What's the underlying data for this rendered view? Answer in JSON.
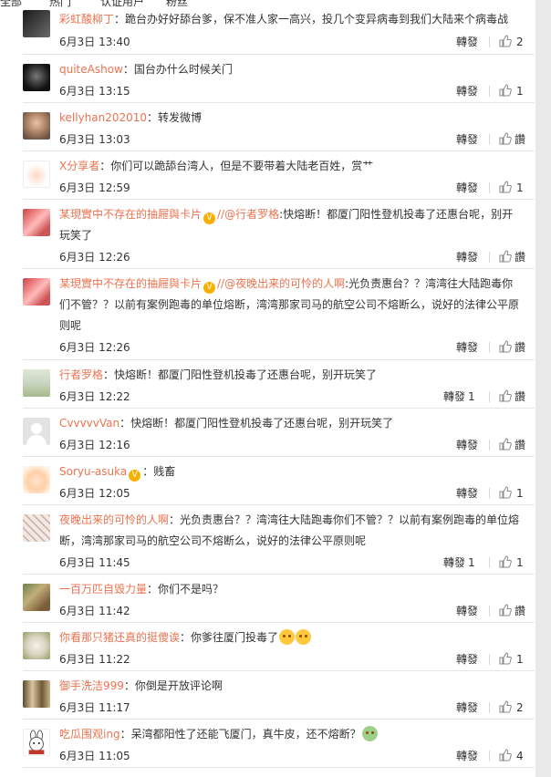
{
  "header_tabs": [
    "全部",
    "热门",
    "认证用户",
    "粉丝"
  ],
  "labels": {
    "repost": "轉發",
    "praise": "讚"
  },
  "colors": {
    "username": "#eb7350",
    "text": "#333333",
    "separator": "#e6e6e6"
  },
  "comments": [
    {
      "user": "彩虹酸柳丁",
      "text": "：跪台办好好舔台爹，保不准人家一高兴，投几个变异病毒到我们大陆来个病毒战",
      "time": "6月3日 13:40",
      "likes": "2",
      "avatar": "anime-girl-avatar"
    },
    {
      "user": "quiteAshow",
      "text": "：国台办什么时候关门",
      "time": "6月3日 13:15",
      "likes": "1",
      "avatar": "dark-face-avatar"
    },
    {
      "user": "kellyhan202010",
      "text": "：转发微博",
      "time": "6月3日 13:03",
      "likes": "讚",
      "avatar": "man-photo-avatar"
    },
    {
      "user": "X分享者",
      "text": "：你们可以跪舔台湾人，但是不要带着大陆老百姓，赏艹",
      "time": "6月3日 12:59",
      "likes": "1",
      "avatar": "cartoon-avatar"
    },
    {
      "user": "某現實中不存在的抽屜與卡片",
      "mention": "//@行者罗格",
      "text": ":快熔断！都厦门阳性登机投毒了还惠台呢，别开玩笑了",
      "time": "6月3日 12:26",
      "likes": "讚",
      "avatar": "food-photo-avatar"
    },
    {
      "user": "某現實中不存在的抽屜與卡片",
      "mention": "//@夜晚出来的可怜的人啊",
      "text": ":光负责惠台？？湾湾往大陆跑毒你们不管？？以前有案例跑毒的单位熔断，湾湾那家司马的航空公司不熔断么，说好的法律公平原则呢",
      "time": "6月3日 12:26",
      "likes": "讚",
      "avatar": "food-photo-avatar-2"
    },
    {
      "user": "行者罗格",
      "text": "：快熔断！都厦门阳性登机投毒了还惠台呢，别开玩笑了",
      "time": "6月3日 12:22",
      "reposts": "1",
      "likes": "讚",
      "avatar": "building-avatar"
    },
    {
      "user": "CvvvvvVan",
      "text": "：快熔断！都厦门阳性登机投毒了还惠台呢，别开玩笑了",
      "time": "6月3日 12:16",
      "likes": "讚",
      "avatar": "default-avatar"
    },
    {
      "user": "Soryu-asuka",
      "text": "：贱畜",
      "time": "6月3日 12:05",
      "likes": "1",
      "avatar": "baby-avatar"
    },
    {
      "user": "夜晚出来的可怜的人啊",
      "text": "：光负责惠台？？湾湾往大陆跑毒你们不管？？以前有案例跑毒的单位熔断，湾湾那家司马的航空公司不熔断么，说好的法律公平原则呢",
      "time": "6月3日 11:45",
      "reposts": "1",
      "likes": "1",
      "avatar": "pattern-avatar"
    },
    {
      "user": "一百万匹自毁力量",
      "text": "：你们不是吗？",
      "time": "6月3日 11:42",
      "likes": "讚",
      "avatar": "photo-avatar"
    },
    {
      "user": "你看那只猪还真的挺傻诶",
      "text": "：你爹往厦门投毒了",
      "time": "6月3日 11:22",
      "likes": "1",
      "avatar": "alpaca-avatar"
    },
    {
      "user": "御手洗洁999",
      "text": "：你倒是开放评论啊",
      "time": "6月3日 11:17",
      "likes": "2",
      "avatar": "bottle-avatar"
    },
    {
      "user": "吃瓜围观ing",
      "text": "：呆湾都阳性了还能飞厦门，真牛皮，还不熔断？",
      "time": "6月3日 11:05",
      "likes": "4",
      "avatar": "rabbit-avatar"
    }
  ]
}
